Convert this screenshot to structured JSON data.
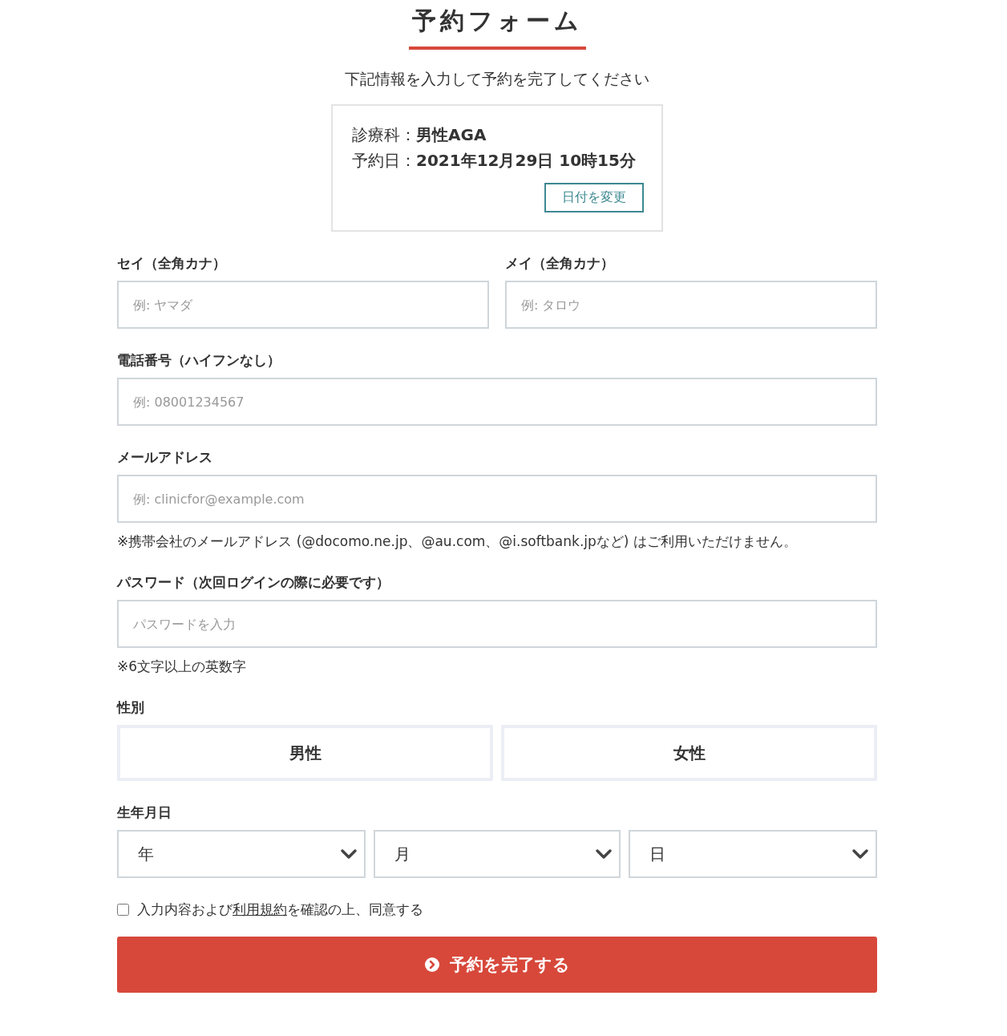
{
  "title": "予約フォーム",
  "subtitle": "下記情報を入力して予約を完了してください",
  "summary": {
    "rows": [
      {
        "label": "診療科：",
        "value": "男性AGA"
      },
      {
        "label": "予約日：",
        "value": "2021年12月29日 10時15分"
      }
    ],
    "button": "日付を変更"
  },
  "name_fields": [
    {
      "label": "セイ（全角カナ）",
      "placeholder": "例: ヤマダ"
    },
    {
      "label": "メイ（全角カナ）",
      "placeholder": "例: タロウ"
    }
  ],
  "fields": [
    {
      "label": "電話番号（ハイフンなし）",
      "placeholder": "例: 08001234567"
    },
    {
      "label": "メールアドレス",
      "placeholder": "例: clinicfor@example.com",
      "note": "※携帯会社のメールアドレス (@docomo.ne.jp、@au.com、@i.softbank.jpなど) はご利用いただけません。"
    },
    {
      "label": "パスワード（次回ログインの際に必要です）",
      "placeholder": "パスワードを入力",
      "note": "※6文字以上の英数字"
    }
  ],
  "gender": {
    "label": "性別",
    "options": [
      {
        "label": "男性",
        "selected": false
      },
      {
        "label": "女性",
        "selected": false
      }
    ]
  },
  "birthdate": {
    "label": "生年月日",
    "selects": [
      {
        "value": "年"
      },
      {
        "value": "月"
      },
      {
        "value": "日"
      }
    ]
  },
  "agree": {
    "checked": false,
    "text_before": "入力内容および",
    "link": "利用規約",
    "text_after": "を確認の上、同意する"
  },
  "submit": "予約を完了する"
}
